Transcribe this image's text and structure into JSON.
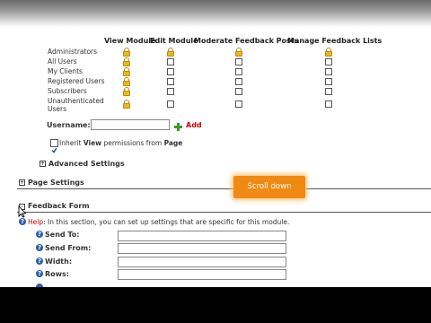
{
  "permissions": {
    "columns": [
      "View Module",
      "Edit Module",
      "Moderate Feedback Posts",
      "Manage Feedback Lists"
    ],
    "rows": [
      {
        "label": "Administrators",
        "cells": [
          "lock",
          "lock",
          "lock",
          "lock"
        ]
      },
      {
        "label": "All Users",
        "cells": [
          "lock",
          "box",
          "box",
          "box"
        ]
      },
      {
        "label": "My Clients",
        "cells": [
          "lock",
          "box",
          "box",
          "box"
        ]
      },
      {
        "label": "Registered Users",
        "cells": [
          "lock",
          "box",
          "box",
          "box"
        ]
      },
      {
        "label": "Subscribers",
        "cells": [
          "lock",
          "box",
          "box",
          "box"
        ]
      },
      {
        "label": "Unauthenticated Users",
        "cells": [
          "lock",
          "box",
          "box",
          "box"
        ]
      }
    ]
  },
  "username": {
    "label": "Username:",
    "value": "",
    "add_label": "Add"
  },
  "inherit": {
    "prefix": "Inherit ",
    "bold1": "View",
    "middle": " permissions from ",
    "bold2": "Page",
    "checked": true
  },
  "advanced_settings": {
    "label": "Advanced Settings",
    "expander": "+"
  },
  "page_settings": {
    "label": "Page Settings",
    "expander": "+"
  },
  "feedback_form": {
    "label": "Feedback Form",
    "expander": "-"
  },
  "help": {
    "label": "Help",
    "text": ": In this section, you can set up settings that are specific for this module."
  },
  "fields": [
    {
      "label": "Send To:",
      "value": ""
    },
    {
      "label": "Send From:",
      "value": ""
    },
    {
      "label": "Width:",
      "value": ""
    },
    {
      "label": "Rows:",
      "value": ""
    }
  ],
  "overlay": {
    "label": "Scroll down",
    "color": "#f08a12"
  },
  "colors": {
    "accent_orange": "#f08a12",
    "help_red": "#cc0000",
    "lock_gold": "#e8b820"
  }
}
